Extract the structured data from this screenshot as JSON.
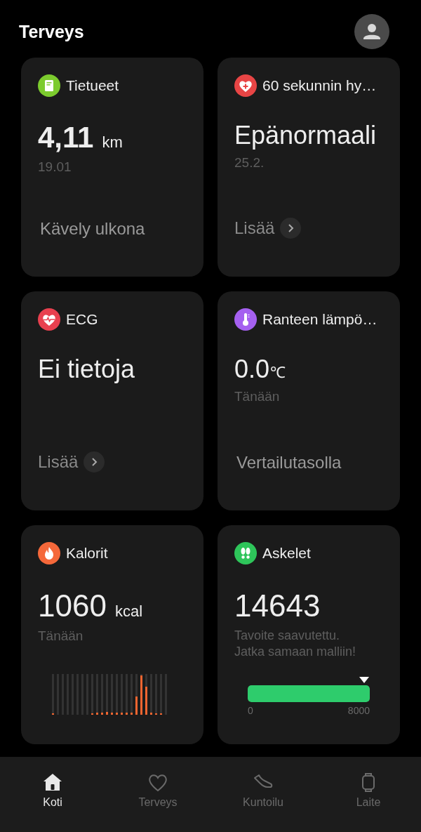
{
  "header": {
    "title": "Terveys"
  },
  "cards": [
    {
      "kind": "record",
      "title": "Tietueet",
      "color": "#7ccb2e",
      "value": "4,11",
      "unit": "km",
      "sub": "19.01",
      "footer": {
        "kind": "text",
        "label": "Kävely ulkona"
      }
    },
    {
      "kind": "status",
      "title": "60 sekunnin hy…",
      "color": "#e84545",
      "value": "Epänormaali",
      "sub": "25.2.",
      "footer": {
        "kind": "link",
        "label": "Lisää"
      }
    },
    {
      "kind": "status",
      "title": "ECG",
      "color": "#e8404f",
      "value": "Ei tietoja",
      "footer": {
        "kind": "link",
        "label": "Lisää"
      }
    },
    {
      "kind": "status",
      "title": "Ranteen lämpö…",
      "color": "#a560f0",
      "value": "0.0",
      "unit": "℃",
      "sub": "Tänään",
      "footer": {
        "kind": "text",
        "label": "Vertailutasolla"
      }
    },
    {
      "kind": "calories",
      "title": "Kalorit",
      "color": "#f5683a",
      "value": "1060",
      "unit": "kcal",
      "sub": "Tänään"
    },
    {
      "kind": "steps",
      "title": "Askelet",
      "color": "#2ec55a",
      "value": "14643",
      "sub": "Tavoite saavutettu.\nJatka samaan malliin!",
      "progress": {
        "level": 1,
        "min": "0",
        "max": "8000"
      }
    }
  ],
  "nav": [
    {
      "label": "Koti",
      "selected": true
    },
    {
      "label": "Terveys",
      "selected": false
    },
    {
      "label": "Kuntoilu",
      "selected": false
    },
    {
      "label": "Laite",
      "selected": false
    }
  ]
}
